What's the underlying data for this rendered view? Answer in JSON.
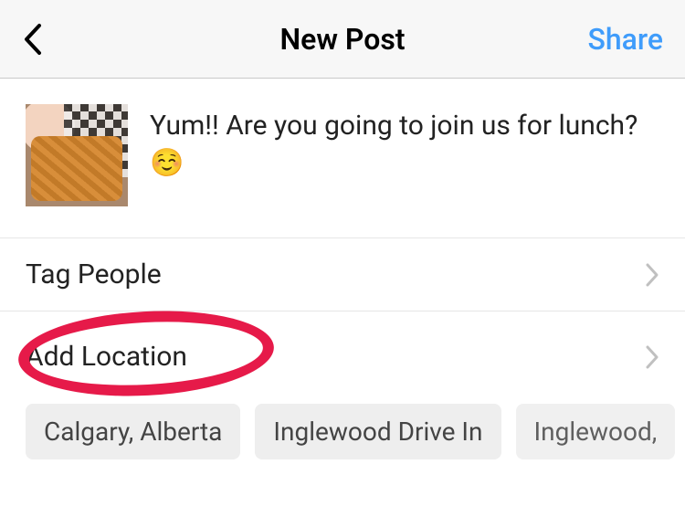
{
  "header": {
    "title": "New Post",
    "share_label": "Share"
  },
  "caption": {
    "text": "Yum!! Are you going to join us for lunch? ☺️"
  },
  "rows": {
    "tag_people": "Tag People",
    "add_location": "Add Location"
  },
  "location_suggestions": [
    "Calgary, Alberta",
    "Inglewood Drive In",
    "Inglewood,"
  ]
}
